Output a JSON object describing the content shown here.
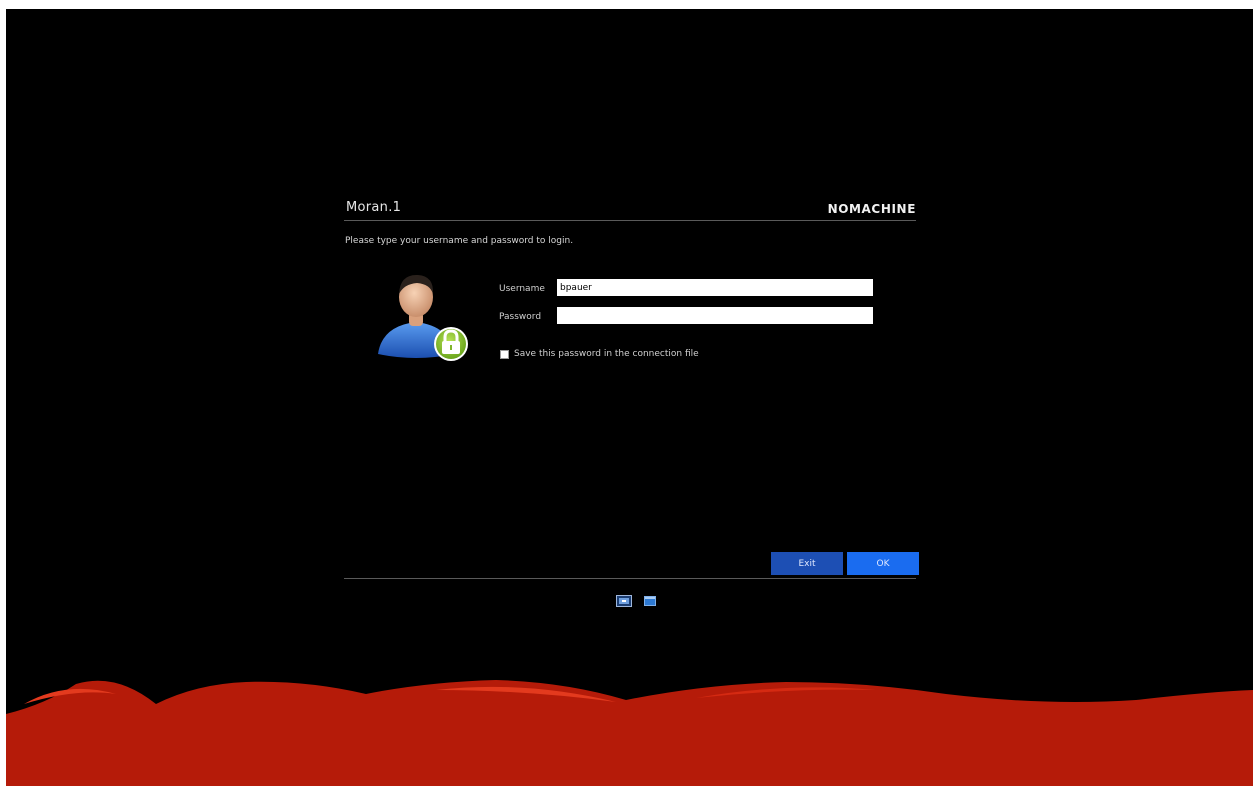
{
  "dialog": {
    "title": "Moran.1",
    "brand": "NOMACHINE",
    "prompt": "Please type your username and password to login."
  },
  "form": {
    "username_label": "Username",
    "username_value": "bpauer",
    "password_label": "Password",
    "password_value": "",
    "save_password_label": "Save this password in the connection file",
    "save_password_checked": false
  },
  "buttons": {
    "exit_label": "Exit",
    "ok_label": "OK"
  },
  "icons": {
    "avatar": "user-lock-icon",
    "view_1": "screen-mode-icon",
    "view_2": "window-mode-icon"
  },
  "colors": {
    "background": "#000000",
    "wave": "#b51b09",
    "ok_button": "#1a6cf0",
    "exit_button": "#1d4fb4"
  }
}
